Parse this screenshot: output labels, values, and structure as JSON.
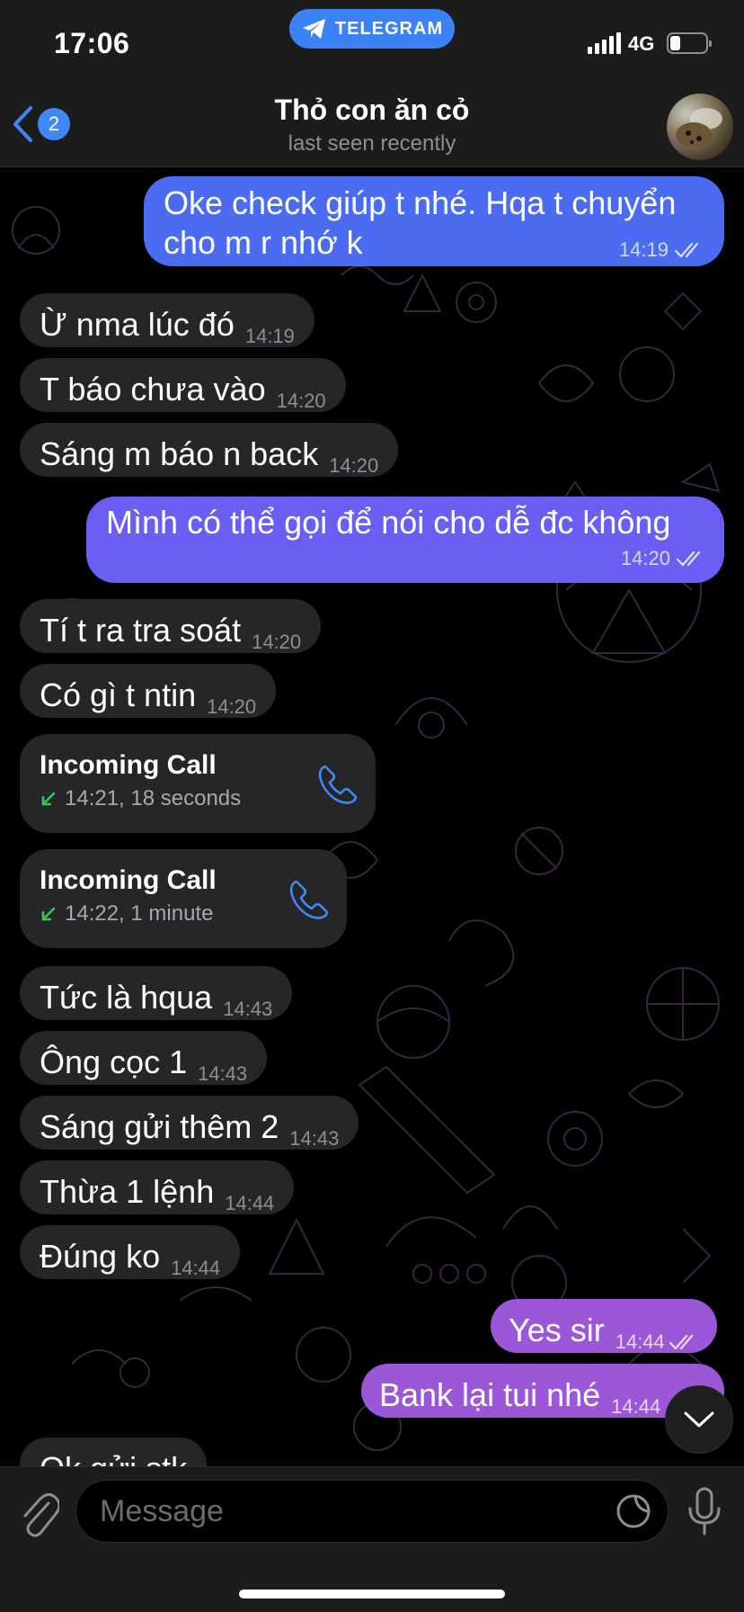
{
  "status_bar": {
    "time": "17:06",
    "app_pill": "TELEGRAM",
    "network": "4G",
    "battery_level": 0.3
  },
  "header": {
    "back_badge": "2",
    "title": "Thỏ con ăn cỏ",
    "subtitle": "last seen recently",
    "avatar_icon": "profile-photo"
  },
  "messages": [
    {
      "dir": "out",
      "text_line1": "Oke check giúp t nhé. Hqa t chuyển",
      "text_line2": "cho m r nhớ k",
      "time": "14:19"
    },
    {
      "dir": "in",
      "text": "Ừ nma lúc đó",
      "time": "14:19"
    },
    {
      "dir": "in",
      "text": "T báo chưa vào",
      "time": "14:20"
    },
    {
      "dir": "in",
      "text": "Sáng m báo n back",
      "time": "14:20"
    },
    {
      "dir": "out",
      "text": "Mình có thể gọi để nói cho dễ đc không",
      "time": "14:20"
    },
    {
      "dir": "in",
      "text": "Tí t ra tra soát",
      "time": "14:20"
    },
    {
      "dir": "in",
      "text": "Có gì t ntin",
      "time": "14:20"
    },
    {
      "dir": "call",
      "title": "Incoming Call",
      "detail": "14:21, 18 seconds"
    },
    {
      "dir": "call",
      "title": "Incoming Call",
      "detail": "14:22, 1 minute"
    },
    {
      "dir": "in",
      "text": "Tức là hqua",
      "time": "14:43"
    },
    {
      "dir": "in",
      "text": "Ông cọc 1",
      "time": "14:43"
    },
    {
      "dir": "in",
      "text": "Sáng gửi thêm 2",
      "time": "14:43"
    },
    {
      "dir": "in",
      "text": "Thừa 1 lệnh",
      "time": "14:44"
    },
    {
      "dir": "in",
      "text": "Đúng ko",
      "time": "14:44"
    },
    {
      "dir": "out",
      "text": "Yes sir",
      "time": "14:44"
    },
    {
      "dir": "out",
      "text": "Bank lại tui nhé",
      "time": "14:44"
    },
    {
      "dir": "in",
      "text": "Ok gửi stk",
      "time": ""
    }
  ],
  "input": {
    "placeholder": "Message"
  },
  "colors": {
    "outgoing_bubble_start": "#4c6ef5",
    "outgoing_bubble_end": "#9b59d0",
    "incoming_bubble": "#262628",
    "accent": "#3e88f7",
    "call_received_arrow": "#34c759"
  }
}
